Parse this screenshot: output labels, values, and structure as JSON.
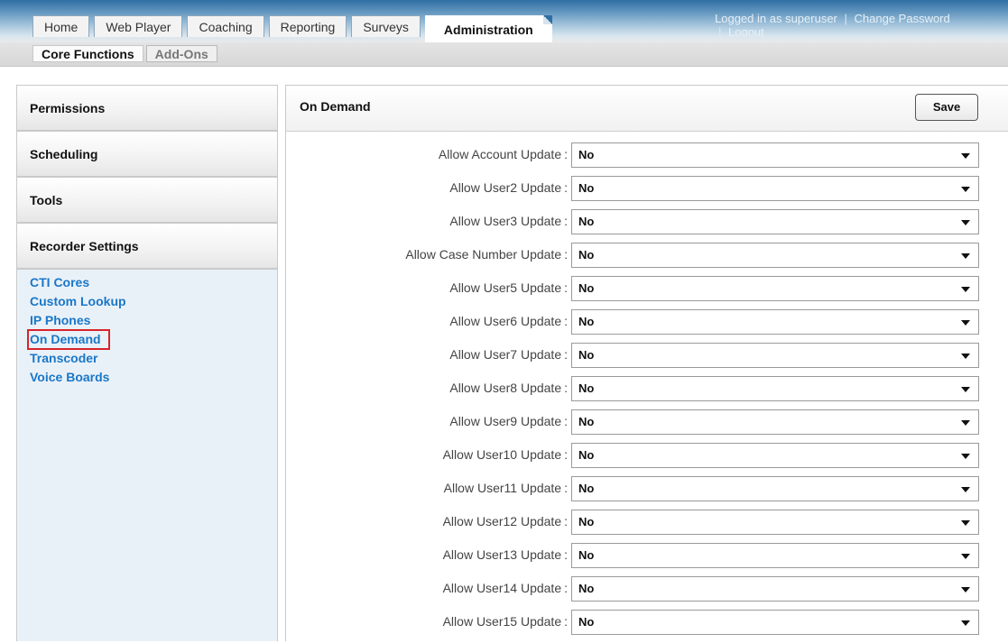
{
  "nav": {
    "tabs": [
      {
        "label": "Home"
      },
      {
        "label": "Web Player"
      },
      {
        "label": "Coaching"
      },
      {
        "label": "Reporting"
      },
      {
        "label": "Surveys"
      },
      {
        "label": "Administration",
        "active": true
      }
    ],
    "subtabs": [
      {
        "label": "Core Functions",
        "active": true
      },
      {
        "label": "Add-Ons"
      }
    ],
    "user": {
      "logged_in": "Logged in as superuser",
      "change_password": "Change Password",
      "logout": "Logout",
      "separator": "|"
    }
  },
  "sidebar": {
    "sections": [
      {
        "label": "Permissions"
      },
      {
        "label": "Scheduling"
      },
      {
        "label": "Tools"
      },
      {
        "label": "Recorder Settings"
      }
    ],
    "links": [
      {
        "label": "CTI Cores"
      },
      {
        "label": "Custom Lookup"
      },
      {
        "label": "IP Phones"
      },
      {
        "label": "On Demand",
        "selected": true
      },
      {
        "label": "Transcoder"
      },
      {
        "label": "Voice Boards"
      }
    ]
  },
  "panel": {
    "title": "On Demand",
    "save_label": "Save",
    "fields": [
      {
        "label": "Allow Account Update",
        "value": "No"
      },
      {
        "label": "Allow User2 Update",
        "value": "No"
      },
      {
        "label": "Allow User3 Update",
        "value": "No"
      },
      {
        "label": "Allow Case Number Update",
        "value": "No"
      },
      {
        "label": "Allow User5 Update",
        "value": "No"
      },
      {
        "label": "Allow User6 Update",
        "value": "No"
      },
      {
        "label": "Allow User7 Update",
        "value": "No"
      },
      {
        "label": "Allow User8 Update",
        "value": "No"
      },
      {
        "label": "Allow User9 Update",
        "value": "No"
      },
      {
        "label": "Allow User10 Update",
        "value": "No"
      },
      {
        "label": "Allow User11 Update",
        "value": "No"
      },
      {
        "label": "Allow User12 Update",
        "value": "No"
      },
      {
        "label": "Allow User13 Update",
        "value": "No"
      },
      {
        "label": "Allow User14 Update",
        "value": "No"
      },
      {
        "label": "Allow User15 Update",
        "value": "No"
      }
    ],
    "colon": ":"
  },
  "colors": {
    "header_blue": "#2f6fa4",
    "link_blue": "#1a77c8",
    "highlight_red": "#d8232a",
    "sidebar_bg": "#e9f1f8"
  }
}
